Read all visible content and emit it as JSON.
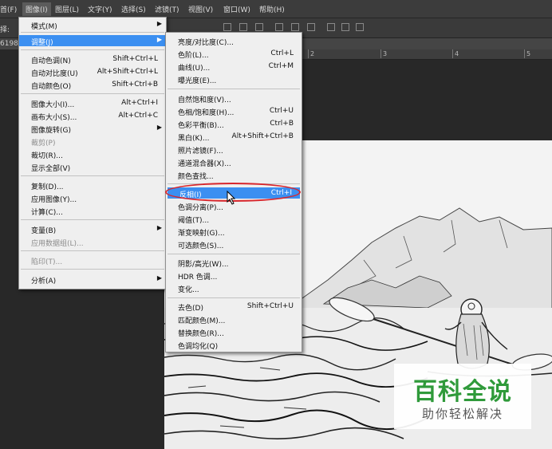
{
  "menubar": {
    "items": [
      "首(F)",
      "图像(I)",
      "图层(L)",
      "文字(Y)",
      "选择(S)",
      "滤镜(T)",
      "视图(V)",
      "窗口(W)",
      "帮助(H)"
    ],
    "active_index": 1
  },
  "options_bar": {
    "label": "择:"
  },
  "document_tab": {
    "label": "6198"
  },
  "ruler": {
    "ticks": [
      "2",
      "3",
      "4",
      "5"
    ]
  },
  "image_menu": {
    "items": [
      {
        "label": "模式(M)",
        "shortcut": "",
        "submenu": true,
        "disabled": false
      },
      {
        "label": "调整(J)",
        "shortcut": "",
        "submenu": true,
        "disabled": false,
        "highlighted": true
      },
      {
        "label": "自动色调(N)",
        "shortcut": "Shift+Ctrl+L",
        "submenu": false,
        "disabled": false
      },
      {
        "label": "自动对比度(U)",
        "shortcut": "Alt+Shift+Ctrl+L",
        "submenu": false,
        "disabled": false
      },
      {
        "label": "自动颜色(O)",
        "shortcut": "Shift+Ctrl+B",
        "submenu": false,
        "disabled": false
      },
      {
        "label": "图像大小(I)...",
        "shortcut": "Alt+Ctrl+I",
        "submenu": false,
        "disabled": false
      },
      {
        "label": "画布大小(S)...",
        "shortcut": "Alt+Ctrl+C",
        "submenu": false,
        "disabled": false
      },
      {
        "label": "图像旋转(G)",
        "shortcut": "",
        "submenu": true,
        "disabled": false
      },
      {
        "label": "裁剪(P)",
        "shortcut": "",
        "submenu": false,
        "disabled": true
      },
      {
        "label": "裁切(R)...",
        "shortcut": "",
        "submenu": false,
        "disabled": false
      },
      {
        "label": "显示全部(V)",
        "shortcut": "",
        "submenu": false,
        "disabled": false
      },
      {
        "label": "复制(D)...",
        "shortcut": "",
        "submenu": false,
        "disabled": false
      },
      {
        "label": "应用图像(Y)...",
        "shortcut": "",
        "submenu": false,
        "disabled": false
      },
      {
        "label": "计算(C)...",
        "shortcut": "",
        "submenu": false,
        "disabled": false
      },
      {
        "label": "变量(B)",
        "shortcut": "",
        "submenu": true,
        "disabled": false
      },
      {
        "label": "应用数据组(L)...",
        "shortcut": "",
        "submenu": false,
        "disabled": true
      },
      {
        "label": "陷印(T)...",
        "shortcut": "",
        "submenu": false,
        "disabled": true
      },
      {
        "label": "分析(A)",
        "shortcut": "",
        "submenu": true,
        "disabled": false
      }
    ]
  },
  "adjust_menu": {
    "items": [
      {
        "label": "亮度/对比度(C)...",
        "shortcut": ""
      },
      {
        "label": "色阶(L)...",
        "shortcut": "Ctrl+L"
      },
      {
        "label": "曲线(U)...",
        "shortcut": "Ctrl+M"
      },
      {
        "label": "曝光度(E)...",
        "shortcut": ""
      },
      {
        "label": "自然饱和度(V)...",
        "shortcut": ""
      },
      {
        "label": "色相/饱和度(H)...",
        "shortcut": "Ctrl+U"
      },
      {
        "label": "色彩平衡(B)...",
        "shortcut": "Ctrl+B"
      },
      {
        "label": "黑白(K)...",
        "shortcut": "Alt+Shift+Ctrl+B"
      },
      {
        "label": "照片滤镜(F)...",
        "shortcut": ""
      },
      {
        "label": "通道混合器(X)...",
        "shortcut": ""
      },
      {
        "label": "颜色查找...",
        "shortcut": ""
      },
      {
        "label": "反相(I)",
        "shortcut": "Ctrl+I",
        "highlighted": true
      },
      {
        "label": "色调分离(P)...",
        "shortcut": ""
      },
      {
        "label": "阈值(T)...",
        "shortcut": ""
      },
      {
        "label": "渐变映射(G)...",
        "shortcut": ""
      },
      {
        "label": "可选颜色(S)...",
        "shortcut": ""
      },
      {
        "label": "阴影/高光(W)...",
        "shortcut": ""
      },
      {
        "label": "HDR 色调...",
        "shortcut": ""
      },
      {
        "label": "变化...",
        "shortcut": ""
      },
      {
        "label": "去色(D)",
        "shortcut": "Shift+Ctrl+U"
      },
      {
        "label": "匹配颜色(M)...",
        "shortcut": ""
      },
      {
        "label": "替换颜色(R)...",
        "shortcut": ""
      },
      {
        "label": "色调均化(Q)",
        "shortcut": ""
      }
    ]
  },
  "watermark": {
    "title": "百科全说",
    "subtitle": "助你轻松解决",
    "color": "#2f9a3a"
  },
  "colors": {
    "menu_highlight": "#3b8ff1",
    "annotation_oval": "#d8262c"
  }
}
